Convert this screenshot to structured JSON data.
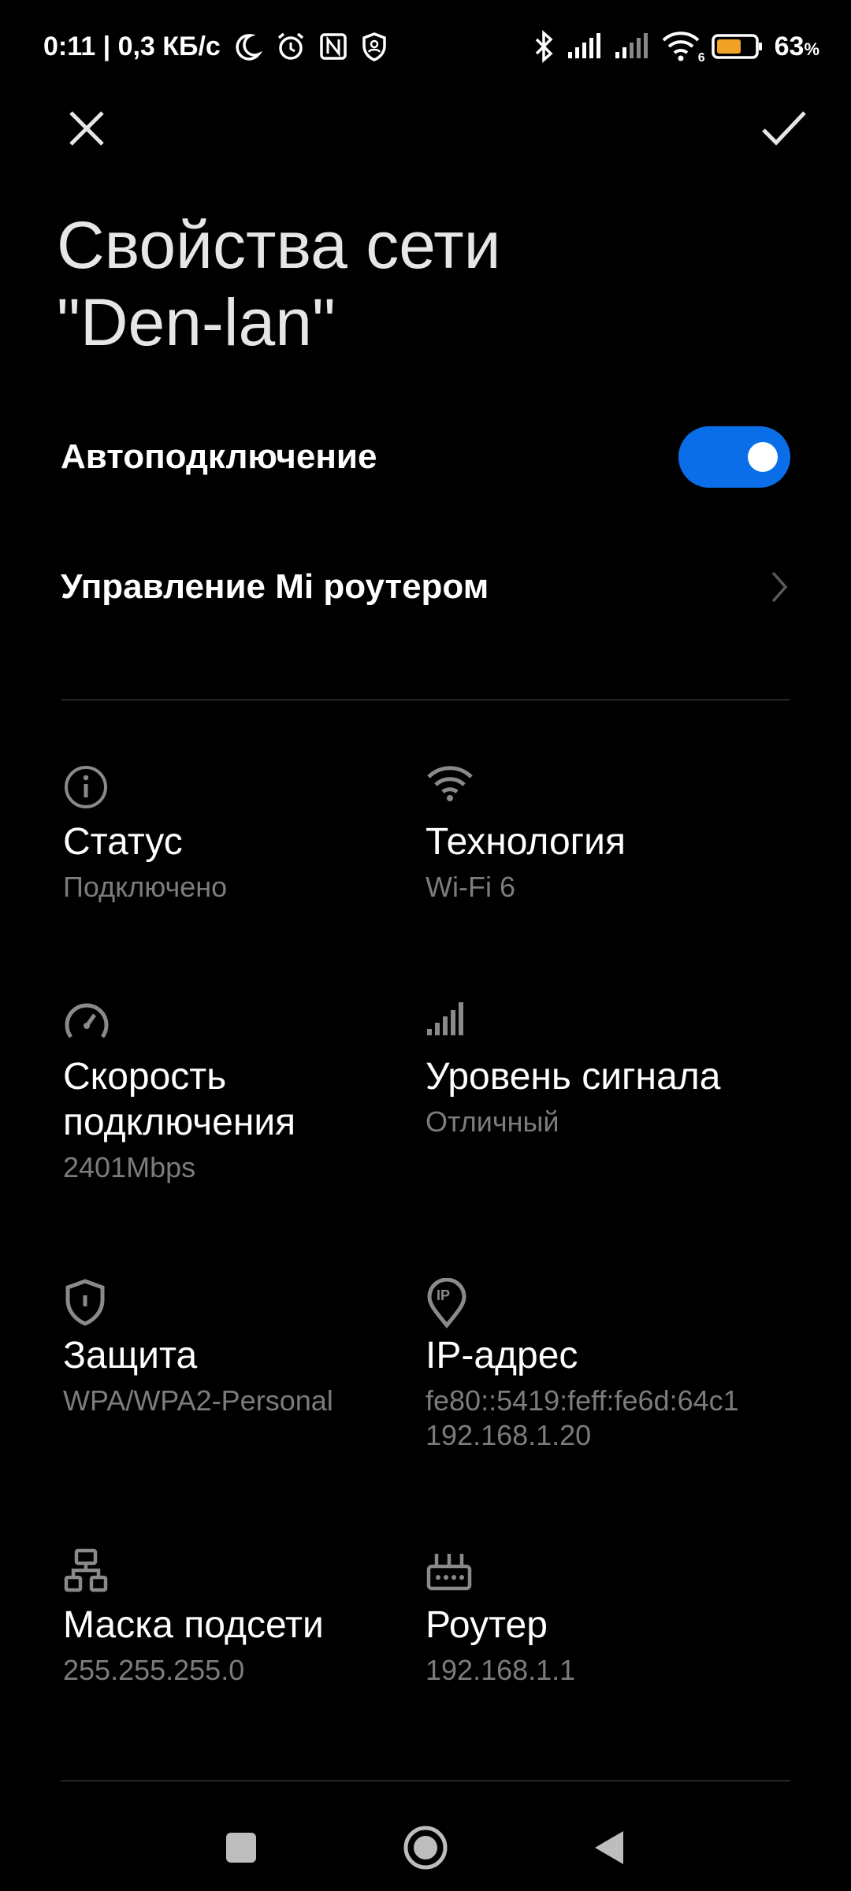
{
  "status_bar": {
    "time_speed": "0:11 | 0,3 КБ/с",
    "battery_percent": "63",
    "battery_unit": "%",
    "wifi_badge": "6",
    "icons": [
      "moon-icon",
      "alarm-icon",
      "nfc-icon",
      "shield-icon",
      "bluetooth-icon",
      "signal-icon",
      "signal-icon-2",
      "wifi-icon",
      "battery-icon"
    ]
  },
  "header": {
    "close_icon": "close-icon",
    "confirm_icon": "check-icon",
    "title_line1": "Свойства сети",
    "title_line2": "\"Den-lan\""
  },
  "settings": {
    "auto_connect_label": "Автоподключение",
    "auto_connect_on": true,
    "router_mgmt_label": "Управление Mi роутером"
  },
  "details": [
    {
      "icon": "info-icon",
      "label": "Статус",
      "value": "Подключено"
    },
    {
      "icon": "wifi-icon",
      "label": "Технология",
      "value": "Wi-Fi 6"
    },
    {
      "icon": "speedometer-icon",
      "label_line1": "Скорость",
      "label_line2": "подключения",
      "value": "2401Mbps"
    },
    {
      "icon": "signal-strength-icon",
      "label": "Уровень сигнала",
      "value": "Отличный"
    },
    {
      "icon": "shield-icon",
      "label": "Защита",
      "value": "WPA/WPA2-Personal"
    },
    {
      "icon": "location-ip-icon",
      "label": "IP-адрес",
      "value_line1": "fe80::5419:feff:fe6d:64c1",
      "value_line2": "192.168.1.20",
      "icon_text": "IP"
    },
    {
      "icon": "network-icon",
      "label": "Маска подсети",
      "value": "255.255.255.0"
    },
    {
      "icon": "router-icon",
      "label": "Роутер",
      "value": "192.168.1.1"
    }
  ],
  "navigation": {
    "buttons": [
      "recents-square-icon",
      "home-circle-icon",
      "back-triangle-icon"
    ]
  },
  "colors": {
    "accent": "#0a6ee8",
    "background": "#000000",
    "secondary_text": "#7c7c7c"
  }
}
